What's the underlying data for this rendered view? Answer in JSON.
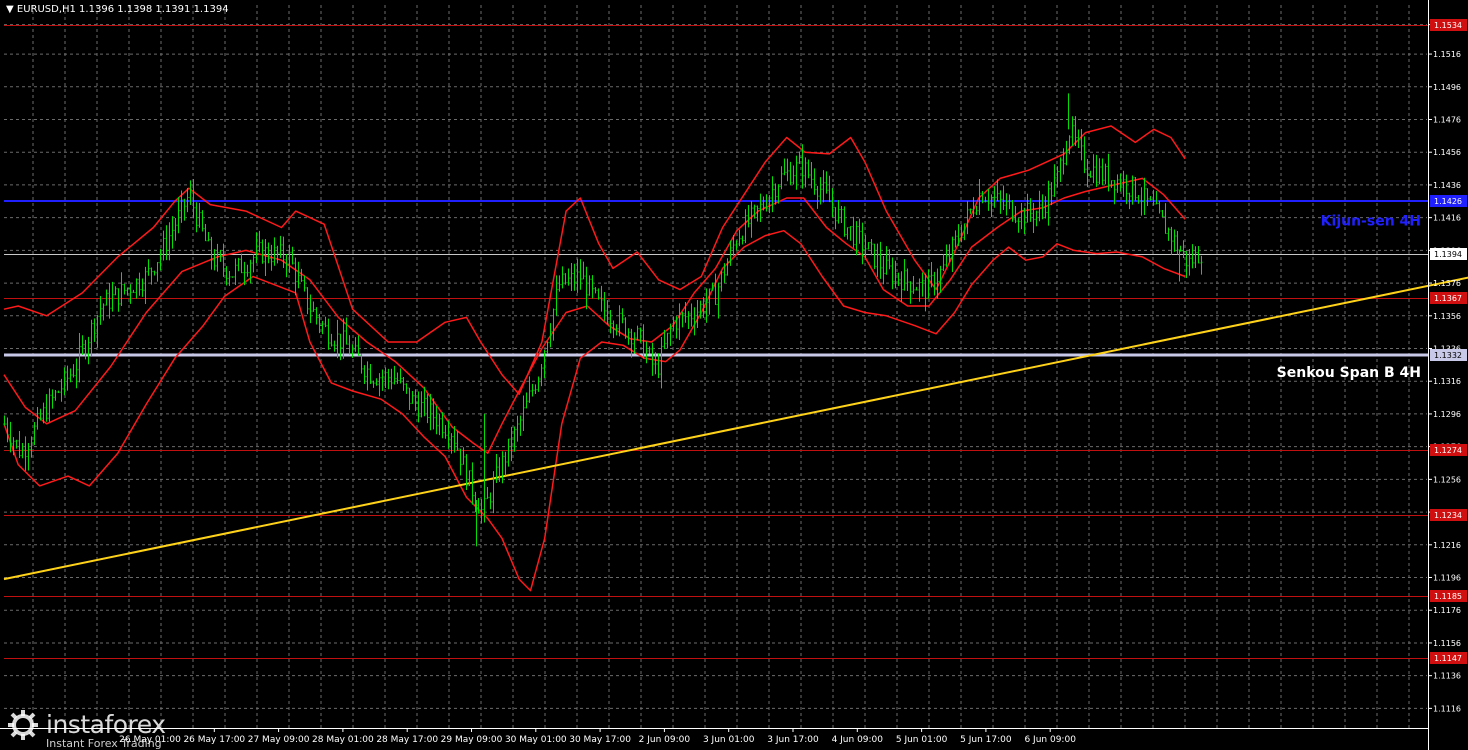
{
  "header": {
    "symbol_line": "▼ EURUSD,H1  1.1396 1.1398 1.1391 1.1394"
  },
  "logo": {
    "name": "instaforex",
    "tagline": "Instant Forex Trading"
  },
  "colors": {
    "background": "#000000",
    "grid": "#6b6b6b",
    "candle": "#00e000",
    "bollinger": "#ff1a1a",
    "level": "#c01010",
    "kijun": "#2020ff",
    "senkou": "#c8c8e8",
    "trendline": "#ffd21a",
    "current_price": "#c8c8c8",
    "level_label_bg": "#d01010",
    "kijun_label": "#2020ff",
    "senkou_label": "#ffffff"
  },
  "chart_data": {
    "type": "candlestick",
    "symbol": "EURUSD",
    "timeframe": "H1",
    "ohlc_header": {
      "open": 1.1396,
      "high": 1.1398,
      "low": 1.1391,
      "close": 1.1394
    },
    "ylim": [
      1.1104,
      1.1546
    ],
    "y_ticks": [
      "1.1534",
      "1.1516",
      "1.1496",
      "1.1476",
      "1.1456",
      "1.1436",
      "1.1416",
      "1.1396",
      "1.1376",
      "1.1356",
      "1.1336",
      "1.1316",
      "1.1296",
      "1.1276",
      "1.1256",
      "1.1236",
      "1.1216",
      "1.1196",
      "1.1176",
      "1.1156",
      "1.1136",
      "1.1116"
    ],
    "x_labels": [
      "26 May 01:00",
      "26 May 17:00",
      "27 May 09:00",
      "28 May 01:00",
      "28 May 17:00",
      "29 May 09:00",
      "30 May 01:00",
      "30 May 17:00",
      "2 Jun 09:00",
      "3 Jun 01:00",
      "3 Jun 17:00",
      "4 Jun 09:00",
      "5 Jun 01:00",
      "5 Jun 17:00",
      "6 Jun 09:00"
    ],
    "current_price": 1.1394,
    "horizontal_levels": [
      {
        "price": 1.1534,
        "label": "1.1534"
      },
      {
        "price": 1.1367,
        "label": "1.1367"
      },
      {
        "price": 1.1274,
        "label": "1.1274"
      },
      {
        "price": 1.1234,
        "label": "1.1234"
      },
      {
        "price": 1.1185,
        "label": "1.1185"
      },
      {
        "price": 1.1147,
        "label": "1.1147"
      }
    ],
    "kijun_sen": {
      "price": 1.1426,
      "label": "1.1426",
      "name": "Kijun-sen 4H"
    },
    "senkou_span_b": {
      "price": 1.1332,
      "label": "1.1332",
      "name": "Senkou Span B 4H"
    },
    "trendline": {
      "start": [
        0,
        1.1195
      ],
      "end": [
        1.133,
        1.1398
      ]
    },
    "anchors": [
      [
        0.0,
        1.129
      ],
      [
        0.012,
        1.1272
      ],
      [
        0.03,
        1.13
      ],
      [
        0.05,
        1.1325
      ],
      [
        0.068,
        1.1362
      ],
      [
        0.09,
        1.1375
      ],
      [
        0.1,
        1.138
      ],
      [
        0.112,
        1.1398
      ],
      [
        0.13,
        1.143
      ],
      [
        0.145,
        1.1392
      ],
      [
        0.16,
        1.1382
      ],
      [
        0.18,
        1.1395
      ],
      [
        0.2,
        1.1392
      ],
      [
        0.212,
        1.1365
      ],
      [
        0.225,
        1.1348
      ],
      [
        0.238,
        1.134
      ],
      [
        0.258,
        1.132
      ],
      [
        0.275,
        1.1318
      ],
      [
        0.285,
        1.1305
      ],
      [
        0.3,
        1.1296
      ],
      [
        0.315,
        1.1285
      ],
      [
        0.325,
        1.1258
      ],
      [
        0.336,
        1.1235
      ],
      [
        0.348,
        1.1262
      ],
      [
        0.362,
        1.129
      ],
      [
        0.375,
        1.132
      ],
      [
        0.39,
        1.1375
      ],
      [
        0.405,
        1.138
      ],
      [
        0.418,
        1.1362
      ],
      [
        0.432,
        1.1352
      ],
      [
        0.446,
        1.1342
      ],
      [
        0.458,
        1.1322
      ],
      [
        0.47,
        1.1352
      ],
      [
        0.485,
        1.1358
      ],
      [
        0.5,
        1.137
      ],
      [
        0.515,
        1.1405
      ],
      [
        0.53,
        1.142
      ],
      [
        0.545,
        1.144
      ],
      [
        0.56,
        1.1448
      ],
      [
        0.575,
        1.1432
      ],
      [
        0.59,
        1.1412
      ],
      [
        0.605,
        1.1398
      ],
      [
        0.618,
        1.1385
      ],
      [
        0.632,
        1.1378
      ],
      [
        0.648,
        1.1372
      ],
      [
        0.66,
        1.1385
      ],
      [
        0.672,
        1.1408
      ],
      [
        0.686,
        1.1432
      ],
      [
        0.7,
        1.1425
      ],
      [
        0.715,
        1.1418
      ],
      [
        0.728,
        1.142
      ],
      [
        0.74,
        1.144
      ],
      [
        0.748,
        1.147
      ],
      [
        0.76,
        1.1448
      ],
      [
        0.772,
        1.1442
      ],
      [
        0.785,
        1.1438
      ],
      [
        0.796,
        1.1432
      ],
      [
        0.808,
        1.142
      ],
      [
        0.82,
        1.1405
      ],
      [
        0.832,
        1.1388
      ],
      [
        0.842,
        1.1396
      ]
    ],
    "wicks": [
      [
        0.332,
        1.1215
      ],
      [
        0.337,
        1.1296
      ],
      [
        0.748,
        1.1492
      ],
      [
        0.826,
        1.1377
      ]
    ],
    "bollinger_upper": [
      [
        0.0,
        1.136
      ],
      [
        0.01,
        1.1362
      ],
      [
        0.03,
        1.1356
      ],
      [
        0.055,
        1.137
      ],
      [
        0.08,
        1.1392
      ],
      [
        0.105,
        1.141
      ],
      [
        0.12,
        1.1426
      ],
      [
        0.13,
        1.1434
      ],
      [
        0.145,
        1.1424
      ],
      [
        0.17,
        1.142
      ],
      [
        0.195,
        1.141
      ],
      [
        0.205,
        1.142
      ],
      [
        0.225,
        1.1412
      ],
      [
        0.245,
        1.136
      ],
      [
        0.27,
        1.134
      ],
      [
        0.29,
        1.134
      ],
      [
        0.31,
        1.1352
      ],
      [
        0.325,
        1.1355
      ],
      [
        0.335,
        1.134
      ],
      [
        0.35,
        1.132
      ],
      [
        0.362,
        1.1308
      ],
      [
        0.378,
        1.134
      ],
      [
        0.395,
        1.142
      ],
      [
        0.405,
        1.1428
      ],
      [
        0.418,
        1.14
      ],
      [
        0.428,
        1.1385
      ],
      [
        0.445,
        1.1395
      ],
      [
        0.46,
        1.1378
      ],
      [
        0.475,
        1.1372
      ],
      [
        0.49,
        1.138
      ],
      [
        0.505,
        1.141
      ],
      [
        0.52,
        1.143
      ],
      [
        0.535,
        1.145
      ],
      [
        0.55,
        1.1465
      ],
      [
        0.563,
        1.1456
      ],
      [
        0.58,
        1.1455
      ],
      [
        0.595,
        1.1465
      ],
      [
        0.605,
        1.145
      ],
      [
        0.62,
        1.142
      ],
      [
        0.64,
        1.139
      ],
      [
        0.655,
        1.1372
      ],
      [
        0.668,
        1.1395
      ],
      [
        0.685,
        1.1428
      ],
      [
        0.7,
        1.144
      ],
      [
        0.72,
        1.1445
      ],
      [
        0.745,
        1.1455
      ],
      [
        0.76,
        1.1468
      ],
      [
        0.778,
        1.1472
      ],
      [
        0.795,
        1.1462
      ],
      [
        0.808,
        1.147
      ],
      [
        0.82,
        1.1465
      ],
      [
        0.83,
        1.1452
      ]
    ],
    "bollinger_middle": [
      [
        0.0,
        1.132
      ],
      [
        0.015,
        1.13
      ],
      [
        0.03,
        1.129
      ],
      [
        0.05,
        1.1298
      ],
      [
        0.075,
        1.1325
      ],
      [
        0.1,
        1.1358
      ],
      [
        0.125,
        1.1383
      ],
      [
        0.15,
        1.1392
      ],
      [
        0.17,
        1.1396
      ],
      [
        0.195,
        1.139
      ],
      [
        0.215,
        1.1378
      ],
      [
        0.235,
        1.1355
      ],
      [
        0.255,
        1.134
      ],
      [
        0.275,
        1.1328
      ],
      [
        0.295,
        1.1312
      ],
      [
        0.315,
        1.1288
      ],
      [
        0.33,
        1.1278
      ],
      [
        0.34,
        1.1272
      ],
      [
        0.35,
        1.129
      ],
      [
        0.362,
        1.131
      ],
      [
        0.378,
        1.1336
      ],
      [
        0.395,
        1.1358
      ],
      [
        0.41,
        1.1362
      ],
      [
        0.425,
        1.135
      ],
      [
        0.44,
        1.1342
      ],
      [
        0.455,
        1.134
      ],
      [
        0.47,
        1.135
      ],
      [
        0.485,
        1.137
      ],
      [
        0.5,
        1.1385
      ],
      [
        0.515,
        1.1408
      ],
      [
        0.53,
        1.142
      ],
      [
        0.55,
        1.1428
      ],
      [
        0.562,
        1.1428
      ],
      [
        0.578,
        1.141
      ],
      [
        0.592,
        1.14
      ],
      [
        0.605,
        1.1392
      ],
      [
        0.618,
        1.1372
      ],
      [
        0.635,
        1.1362
      ],
      [
        0.65,
        1.1362
      ],
      [
        0.665,
        1.1378
      ],
      [
        0.68,
        1.1398
      ],
      [
        0.698,
        1.141
      ],
      [
        0.715,
        1.142
      ],
      [
        0.73,
        1.1422
      ],
      [
        0.745,
        1.1428
      ],
      [
        0.76,
        1.1432
      ],
      [
        0.78,
        1.1436
      ],
      [
        0.8,
        1.144
      ],
      [
        0.815,
        1.143
      ],
      [
        0.83,
        1.1415
      ]
    ],
    "bollinger_lower": [
      [
        0.0,
        1.129
      ],
      [
        0.01,
        1.1265
      ],
      [
        0.025,
        1.1252
      ],
      [
        0.045,
        1.1258
      ],
      [
        0.06,
        1.1252
      ],
      [
        0.08,
        1.1272
      ],
      [
        0.1,
        1.1302
      ],
      [
        0.12,
        1.133
      ],
      [
        0.14,
        1.135
      ],
      [
        0.155,
        1.1368
      ],
      [
        0.175,
        1.138
      ],
      [
        0.19,
        1.1375
      ],
      [
        0.205,
        1.137
      ],
      [
        0.215,
        1.134
      ],
      [
        0.23,
        1.1315
      ],
      [
        0.245,
        1.131
      ],
      [
        0.265,
        1.1305
      ],
      [
        0.28,
        1.1296
      ],
      [
        0.295,
        1.1282
      ],
      [
        0.31,
        1.127
      ],
      [
        0.325,
        1.1245
      ],
      [
        0.34,
        1.1232
      ],
      [
        0.35,
        1.122
      ],
      [
        0.362,
        1.1195
      ],
      [
        0.37,
        1.1188
      ],
      [
        0.38,
        1.122
      ],
      [
        0.392,
        1.129
      ],
      [
        0.405,
        1.133
      ],
      [
        0.42,
        1.134
      ],
      [
        0.435,
        1.1338
      ],
      [
        0.45,
        1.133
      ],
      [
        0.465,
        1.1328
      ],
      [
        0.475,
        1.1335
      ],
      [
        0.49,
        1.1358
      ],
      [
        0.505,
        1.1385
      ],
      [
        0.52,
        1.1398
      ],
      [
        0.535,
        1.1405
      ],
      [
        0.548,
        1.1408
      ],
      [
        0.56,
        1.14
      ],
      [
        0.575,
        1.138
      ],
      [
        0.59,
        1.1362
      ],
      [
        0.605,
        1.1358
      ],
      [
        0.62,
        1.1356
      ],
      [
        0.64,
        1.135
      ],
      [
        0.655,
        1.1345
      ],
      [
        0.668,
        1.1358
      ],
      [
        0.68,
        1.1375
      ],
      [
        0.695,
        1.139
      ],
      [
        0.706,
        1.1398
      ],
      [
        0.718,
        1.139
      ],
      [
        0.73,
        1.1392
      ],
      [
        0.74,
        1.14
      ],
      [
        0.752,
        1.1396
      ],
      [
        0.768,
        1.1394
      ],
      [
        0.782,
        1.1395
      ],
      [
        0.8,
        1.1392
      ],
      [
        0.815,
        1.1385
      ],
      [
        0.83,
        1.138
      ]
    ]
  }
}
